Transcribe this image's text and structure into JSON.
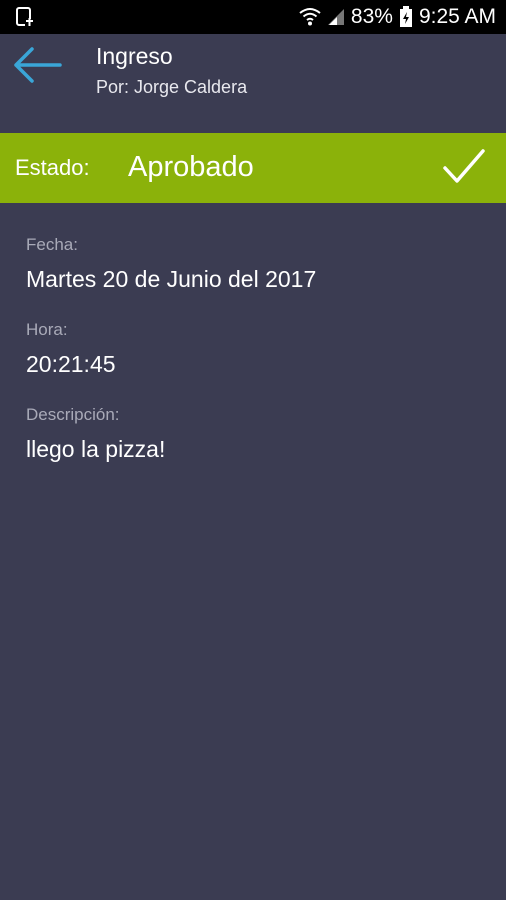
{
  "status_bar": {
    "battery_percent": "83%",
    "time": "9:25 AM",
    "icons": [
      "screenshot-icon",
      "wifi-icon",
      "signal-icon",
      "battery-icon"
    ]
  },
  "app_bar": {
    "title": "Ingreso",
    "subtitle": "Por: Jorge Caldera",
    "back_icon": "arrow-left-icon",
    "accent_color": "#3aa6d8"
  },
  "state": {
    "label": "Estado:",
    "value": "Aprobado",
    "icon": "check-icon",
    "color": "#8bb20a"
  },
  "details": {
    "fecha_label": "Fecha:",
    "fecha_value": "Martes 20 de Junio del 2017",
    "hora_label": "Hora:",
    "hora_value": "20:21:45",
    "descripcion_label": "Descripción:",
    "descripcion_value": "llego la pizza!"
  },
  "colors": {
    "background": "#3b3c52",
    "status_bar": "#000000",
    "label_text": "#a9aab8"
  }
}
